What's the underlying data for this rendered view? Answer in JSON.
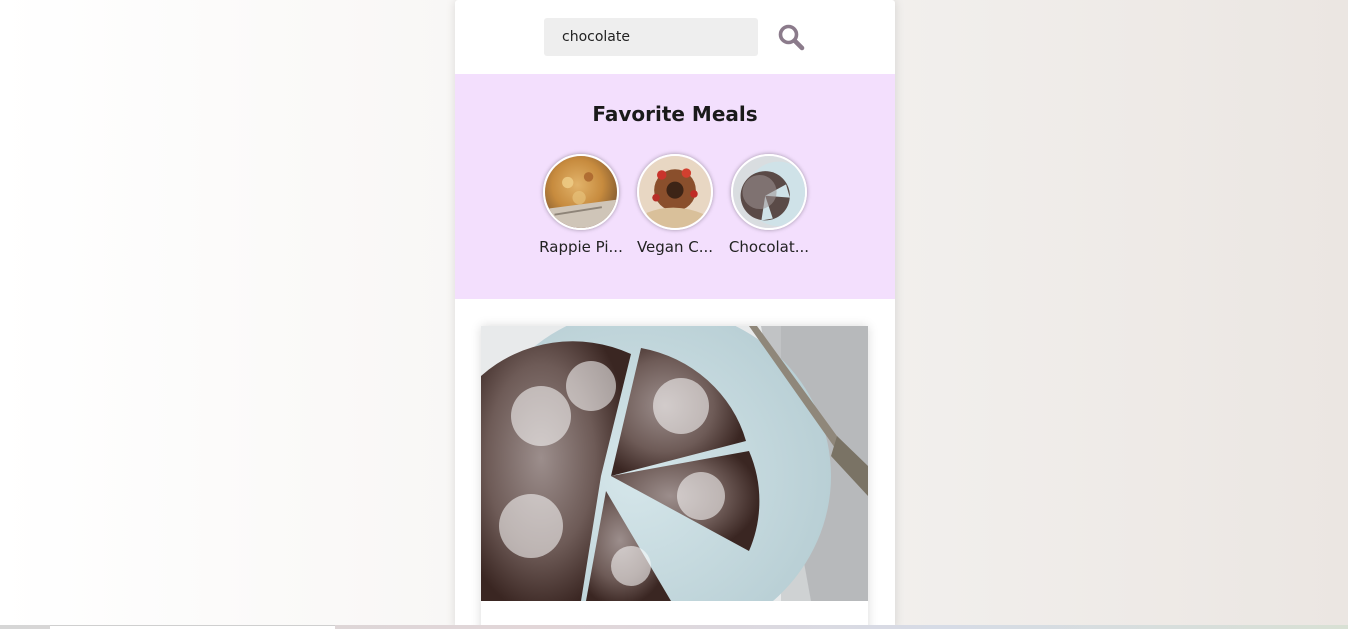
{
  "search": {
    "value": "chocolate",
    "icon": "search-icon"
  },
  "favorites": {
    "title": "Favorite Meals",
    "items": [
      {
        "label": "Rappie Pi..."
      },
      {
        "label": "Vegan C..."
      },
      {
        "label": "Chocolat..."
      }
    ]
  },
  "colors": {
    "favorites_bg": "#f3dffd",
    "search_icon": "#8b7b8b"
  }
}
